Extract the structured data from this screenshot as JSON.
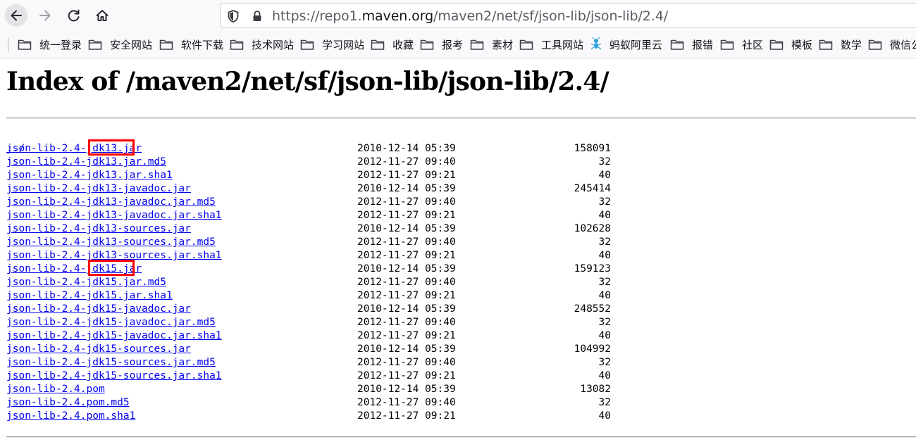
{
  "browser": {
    "url_prefix": "https://repo1.",
    "url_domain": "maven.org",
    "url_path": "/maven2/net/sf/json-lib/json-lib/2.4/",
    "bookmarks": [
      "统一登录",
      "安全网站",
      "软件下载",
      "技术网站",
      "学习网站",
      "收藏",
      "报考",
      "素材",
      "工具网站",
      "蚂蚁阿里云",
      "报错",
      "社区",
      "模板",
      "数学",
      "微信公"
    ]
  },
  "page": {
    "heading": "Index of /maven2/net/sf/json-lib/json-lib/2.4/",
    "parent_link": "../",
    "files": [
      {
        "name": "json-lib-2.4-jdk13.jar",
        "date": "2010-12-14 05:39",
        "size": "158091"
      },
      {
        "name": "json-lib-2.4-jdk13.jar.md5",
        "date": "2012-11-27 09:40",
        "size": "32"
      },
      {
        "name": "json-lib-2.4-jdk13.jar.sha1",
        "date": "2012-11-27 09:21",
        "size": "40"
      },
      {
        "name": "json-lib-2.4-jdk13-javadoc.jar",
        "date": "2010-12-14 05:39",
        "size": "245414"
      },
      {
        "name": "json-lib-2.4-jdk13-javadoc.jar.md5",
        "date": "2012-11-27 09:40",
        "size": "32"
      },
      {
        "name": "json-lib-2.4-jdk13-javadoc.jar.sha1",
        "date": "2012-11-27 09:21",
        "size": "40"
      },
      {
        "name": "json-lib-2.4-jdk13-sources.jar",
        "date": "2010-12-14 05:39",
        "size": "102628"
      },
      {
        "name": "json-lib-2.4-jdk13-sources.jar.md5",
        "date": "2012-11-27 09:40",
        "size": "32"
      },
      {
        "name": "json-lib-2.4-jdk13-sources.jar.sha1",
        "date": "2012-11-27 09:21",
        "size": "40"
      },
      {
        "name": "json-lib-2.4-jdk15.jar",
        "date": "2010-12-14 05:39",
        "size": "159123"
      },
      {
        "name": "json-lib-2.4-jdk15.jar.md5",
        "date": "2012-11-27 09:40",
        "size": "32"
      },
      {
        "name": "json-lib-2.4-jdk15.jar.sha1",
        "date": "2012-11-27 09:21",
        "size": "40"
      },
      {
        "name": "json-lib-2.4-jdk15-javadoc.jar",
        "date": "2010-12-14 05:39",
        "size": "248552"
      },
      {
        "name": "json-lib-2.4-jdk15-javadoc.jar.md5",
        "date": "2012-11-27 09:40",
        "size": "32"
      },
      {
        "name": "json-lib-2.4-jdk15-javadoc.jar.sha1",
        "date": "2012-11-27 09:21",
        "size": "40"
      },
      {
        "name": "json-lib-2.4-jdk15-sources.jar",
        "date": "2010-12-14 05:39",
        "size": "104992"
      },
      {
        "name": "json-lib-2.4-jdk15-sources.jar.md5",
        "date": "2012-11-27 09:40",
        "size": "32"
      },
      {
        "name": "json-lib-2.4-jdk15-sources.jar.sha1",
        "date": "2012-11-27 09:21",
        "size": "40"
      },
      {
        "name": "json-lib-2.4.pom",
        "date": "2010-12-14 05:39",
        "size": "13082"
      },
      {
        "name": "json-lib-2.4.pom.md5",
        "date": "2012-11-27 09:40",
        "size": "32"
      },
      {
        "name": "json-lib-2.4.pom.sha1",
        "date": "2012-11-27 09:21",
        "size": "40"
      }
    ]
  },
  "colors": {
    "link": "#0000ee",
    "highlight": "#ff0000",
    "chrome_bg": "#f9f9fb"
  }
}
